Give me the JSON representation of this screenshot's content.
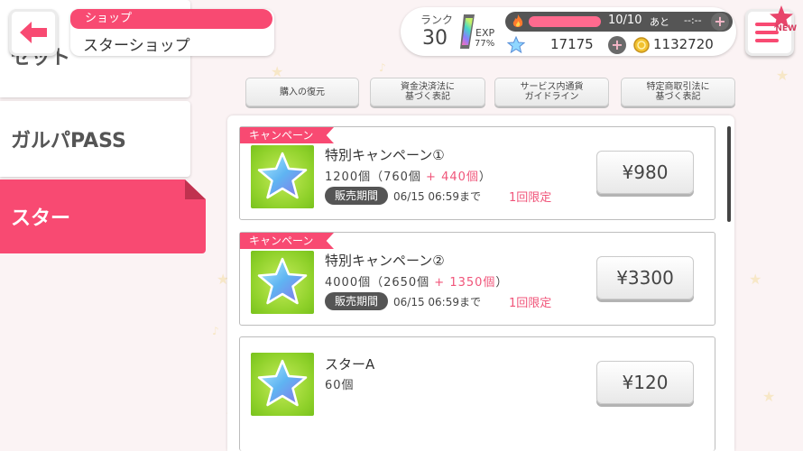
{
  "header": {
    "back_icon": "left-arrow-icon",
    "section_tag": "ショップ",
    "title": "スターショップ",
    "menu_icon": "hamburger-menu-icon",
    "new_badge": "NEW"
  },
  "status": {
    "rank_label": "ランク",
    "rank_value": "30",
    "exp_label": "EXP",
    "exp_percent": "77%",
    "exp_progress": 0.77,
    "stamina": "10/10",
    "stamina_progress": 1.0,
    "stamina_after_label": "あと",
    "stamina_timer": "--:--",
    "stars": "17175",
    "coins": "1132720"
  },
  "sidebar": {
    "items": [
      {
        "label": "セット"
      },
      {
        "label": "ガルパPASS"
      },
      {
        "label": "スター",
        "active": true
      }
    ]
  },
  "links": [
    {
      "line1": "購入の復元",
      "line2": ""
    },
    {
      "line1": "資金決済法に",
      "line2": "基づく表記"
    },
    {
      "line1": "サービス内通貨",
      "line2": "ガイドライン"
    },
    {
      "line1": "特定商取引法に",
      "line2": "基づく表記"
    }
  ],
  "products": [
    {
      "tag": "キャンペーン",
      "name": "特別キャンペーン①",
      "qty_prefix": "1200個（760個",
      "qty_bonus": " + 440個",
      "qty_suffix": "）",
      "period_label": "販売期間",
      "period": "06/15 06:59まで",
      "limit": "1回限定",
      "price": "¥980"
    },
    {
      "tag": "キャンペーン",
      "name": "特別キャンペーン②",
      "qty_prefix": "4000個（2650個",
      "qty_bonus": " + 1350個",
      "qty_suffix": "）",
      "period_label": "販売期間",
      "period": "06/15 06:59まで",
      "limit": "1回限定",
      "price": "¥3300"
    },
    {
      "name": "スターA",
      "qty_prefix": "60個",
      "price": "¥120"
    }
  ],
  "colors": {
    "accent": "#f84a72",
    "dark_badge": "#555555",
    "thumb_green": "#8fd12a"
  }
}
